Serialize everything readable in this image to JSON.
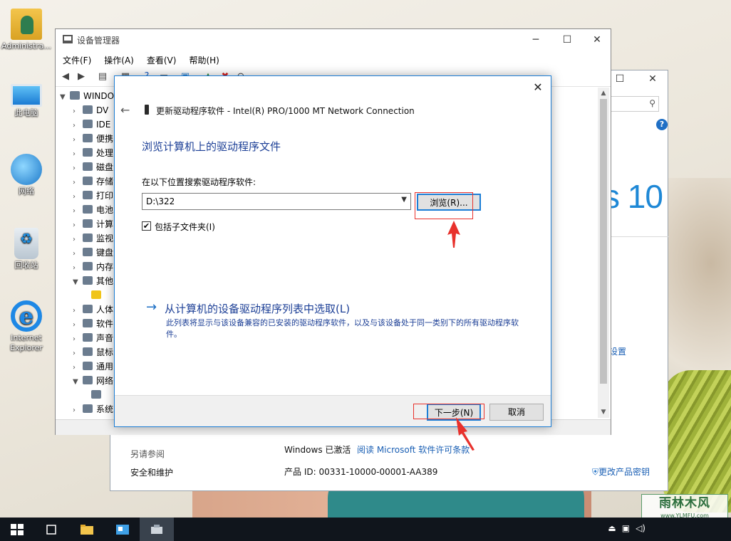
{
  "desktop": {
    "icons": [
      {
        "label": "Administra...",
        "icon": "user-folder-icon"
      },
      {
        "label": "此电脑",
        "icon": "this-pc-icon"
      },
      {
        "label": "网络",
        "icon": "network-icon"
      },
      {
        "label": "回收站",
        "icon": "recycle-bin-icon"
      },
      {
        "label": "Internet\nExplorer",
        "icon": "ie-icon"
      }
    ],
    "watermark": {
      "line1": "雨林木风",
      "line2": "www.YLMFU.com"
    }
  },
  "system_window": {
    "windows_logo_text": "s 10",
    "settings_link": "设置",
    "see_also": "另请参阅",
    "security_link": "安全和维护",
    "activation_status": "Windows 已激活",
    "license_link": "阅读 Microsoft 软件许可条款",
    "product_id": "产品 ID: 00331-10000-00001-AA389",
    "change_key": "更改产品密钥"
  },
  "device_manager": {
    "title": "设备管理器",
    "menu": [
      "文件(F)",
      "操作(A)",
      "查看(V)",
      "帮助(H)"
    ],
    "tree": {
      "root": "WINDO",
      "items": [
        {
          "label": "DV",
          "expanded": false
        },
        {
          "label": "IDE",
          "expanded": false
        },
        {
          "label": "便携",
          "expanded": false
        },
        {
          "label": "处理",
          "expanded": false
        },
        {
          "label": "磁盘",
          "expanded": false
        },
        {
          "label": "存储",
          "expanded": false
        },
        {
          "label": "打印",
          "expanded": false
        },
        {
          "label": "电池",
          "expanded": false
        },
        {
          "label": "计算",
          "expanded": false
        },
        {
          "label": "监视",
          "expanded": false
        },
        {
          "label": "键盘",
          "expanded": false
        },
        {
          "label": "内存",
          "expanded": false
        },
        {
          "label": "其他",
          "expanded": true
        },
        {
          "label": "",
          "child": true,
          "warning": true
        },
        {
          "label": "人体",
          "expanded": false
        },
        {
          "label": "软件",
          "expanded": false
        },
        {
          "label": "声音",
          "expanded": false
        },
        {
          "label": "鼠标",
          "expanded": false
        },
        {
          "label": "通用",
          "expanded": false
        },
        {
          "label": "网络",
          "expanded": true
        },
        {
          "label": "",
          "child": true
        },
        {
          "label": "系统",
          "expanded": false
        }
      ]
    }
  },
  "dialog": {
    "header": "更新驱动程序软件 - Intel(R) PRO/1000 MT Network Connection",
    "heading": "浏览计算机上的驱动程序文件",
    "search_label": "在以下位置搜索驱动程序软件:",
    "path_value": "D:\\322",
    "browse_button": "浏览(R)...",
    "include_subfolders": "包括子文件夹(I)",
    "include_subfolders_checked": true,
    "pick_title": "从计算机的设备驱动程序列表中选取(L)",
    "pick_desc": "此列表将显示与该设备兼容的已安装的驱动程序软件，以及与该设备处于同一类别下的所有驱动程序软件。",
    "next_button": "下一步(N)",
    "cancel_button": "取消"
  },
  "colors": {
    "accent": "#1c7ed6",
    "link": "#1c3f96",
    "annotation": "#e8312c",
    "taskbar": "#10151c"
  }
}
